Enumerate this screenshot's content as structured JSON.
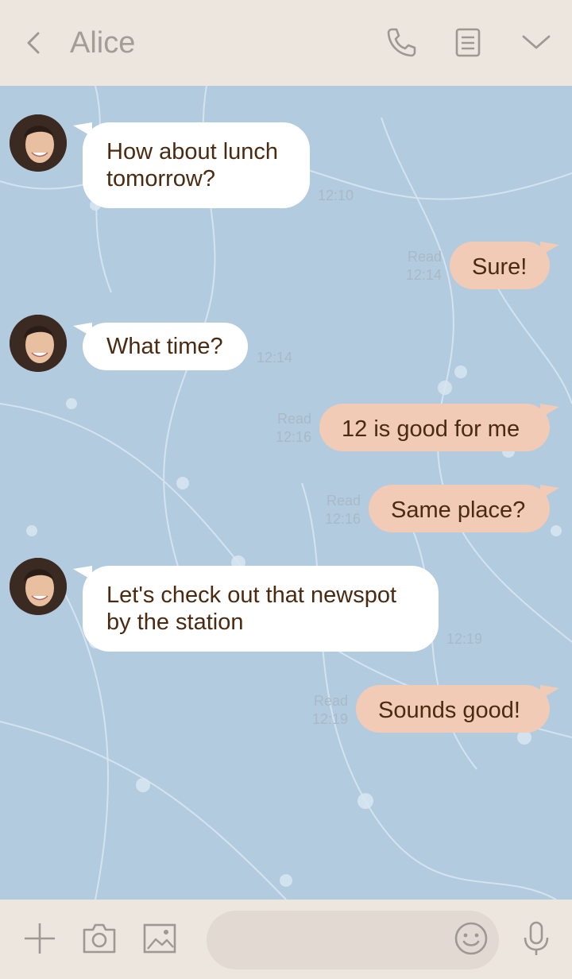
{
  "header": {
    "contact_name": "Alice",
    "icons": [
      "back-chevron-icon",
      "phone-icon",
      "notes-icon",
      "chevron-down-icon"
    ]
  },
  "messages": [
    {
      "direction": "in",
      "text_lines": [
        "How about lunch",
        "tomorrow?"
      ],
      "time": "12:10"
    },
    {
      "direction": "out",
      "text_lines": [
        "Sure!"
      ],
      "read": "Read",
      "time": "12:14"
    },
    {
      "direction": "in",
      "text_lines": [
        "What time?"
      ],
      "time": "12:14"
    },
    {
      "direction": "out",
      "text_lines": [
        "12 is good for me"
      ],
      "read": "Read",
      "time": "12:16"
    },
    {
      "direction": "out",
      "text_lines": [
        "Same place?"
      ],
      "read": "Read",
      "time": "12:16"
    },
    {
      "direction": "in",
      "text_lines": [
        "Let's check out that newspot",
        "by the station"
      ],
      "time": "12:19"
    },
    {
      "direction": "out",
      "text_lines": [
        "Sounds good!"
      ],
      "read": "Read",
      "time": "12:19"
    }
  ],
  "footer": {
    "icons": [
      "plus-icon",
      "camera-icon",
      "image-icon",
      "emoji-icon",
      "microphone-icon"
    ],
    "input_placeholder": ""
  },
  "colors": {
    "header_bg": "#ede6df",
    "chat_bg": "#b3cbdf",
    "incoming_bubble": "#ffffff",
    "outgoing_bubble": "#f1cbb5",
    "text": "#4a2a10"
  }
}
